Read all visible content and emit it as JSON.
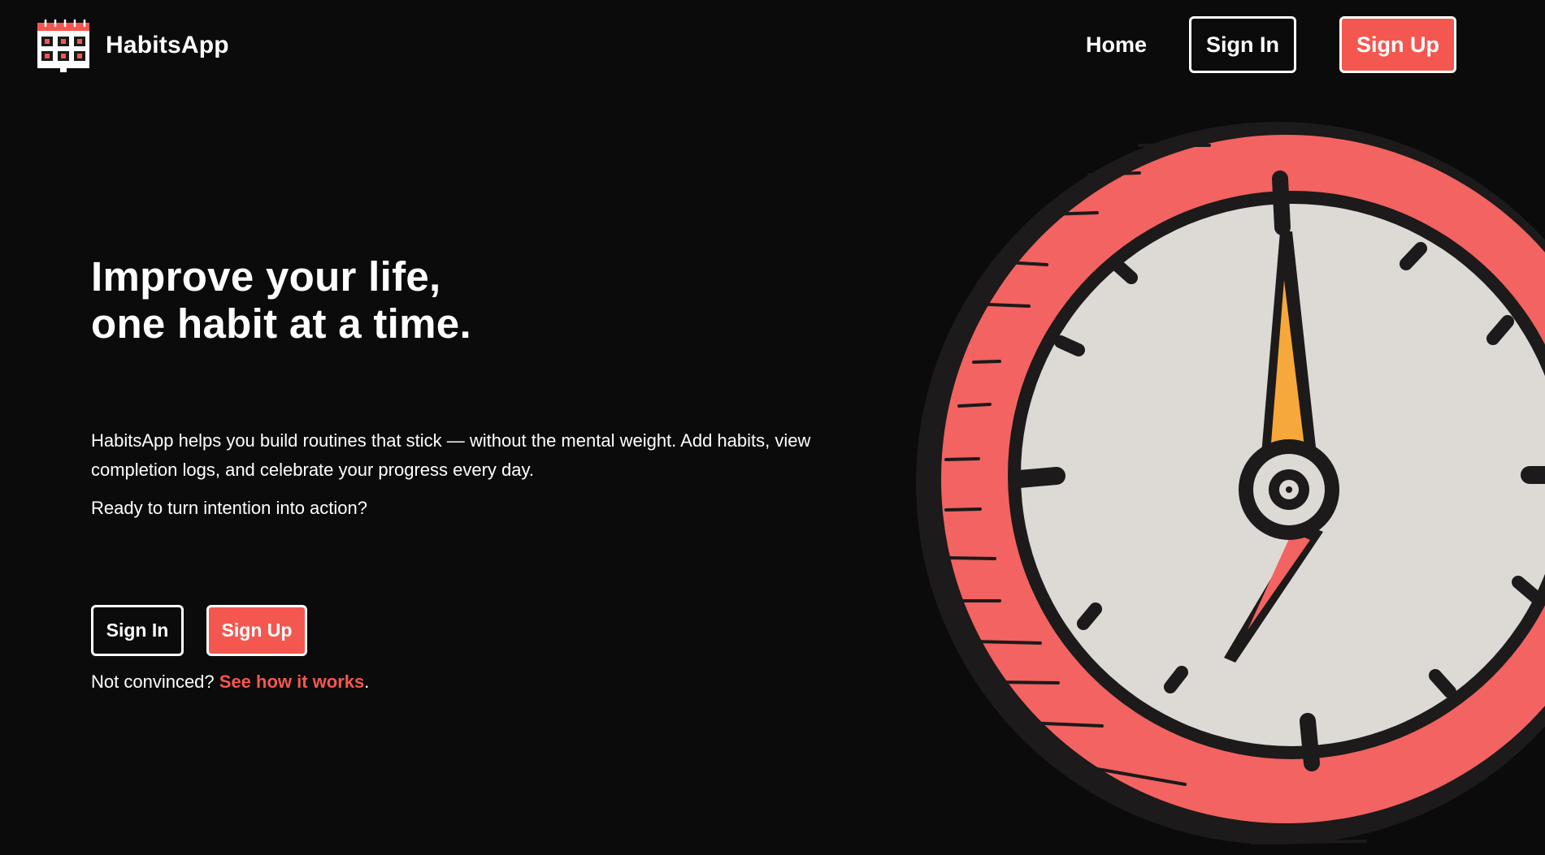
{
  "header": {
    "brand_name": "HabitsApp",
    "nav": {
      "home": "Home",
      "sign_in": "Sign In",
      "sign_up": "Sign Up"
    }
  },
  "hero": {
    "title_line_1": "Improve your life,",
    "title_line_2": "one habit at a time.",
    "description": "HabitsApp helps you build routines that stick — without the mental weight. Add habits, view completion logs, and celebrate your progress every day.",
    "question": "Ready to turn intention into action?",
    "sign_in_label": "Sign In",
    "sign_up_label": "Sign Up",
    "note_prefix": "Not convinced? ",
    "note_link": "See how it works",
    "note_suffix": "."
  },
  "illustration": {
    "icon": "clock-illustration"
  },
  "colors": {
    "background": "#0b0b0b",
    "accent": "#f4574f",
    "clock_ring": "#f26361",
    "clock_face": "#ddd9d5",
    "clock_outline": "#1c1a1a",
    "hand_highlight": "#f7a83a"
  }
}
